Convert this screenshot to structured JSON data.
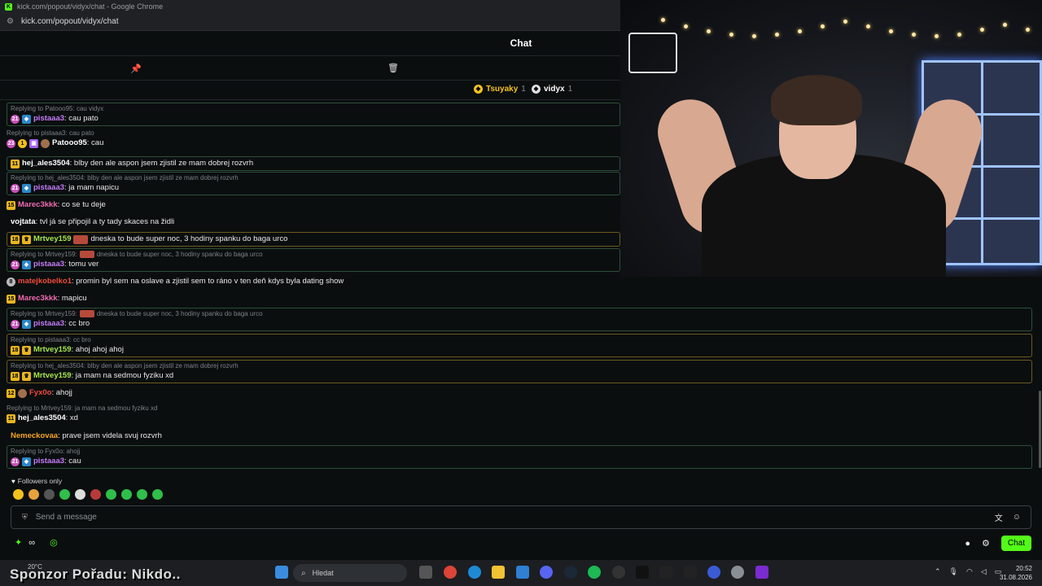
{
  "browser": {
    "window_title": "kick.com/popout/vidyx/chat - Google Chrome",
    "url": "kick.com/popout/vidyx/chat"
  },
  "chat": {
    "title": "Chat",
    "leaderboard": [
      {
        "name": "Tsuyaky",
        "count": "1",
        "color": "#f3c11c"
      },
      {
        "name": "vidyx",
        "count": "1",
        "color": "#ffffff"
      }
    ],
    "messages": [
      {
        "reply": "Replying to Patooo95: cau vidyx",
        "user": "pistaaa3",
        "text": ": cau pato"
      },
      {
        "reply": "Replying to pistaaa3: cau pato",
        "user": "Patooo95",
        "text": ": cau"
      },
      {
        "badge": "11",
        "user": "hej_ales3504",
        "text": ": blby den ale aspon jsem zjistil ze mam dobrej rozvrh"
      },
      {
        "reply": "Replying to hej_ales3504: blby den ale aspon jsem zjistil ze mam dobrej rozvrh",
        "user": "pistaaa3",
        "text": ": ja mam napicu"
      },
      {
        "badge": "15",
        "user": "Marec3kkk",
        "text": ": co se tu deje"
      },
      {
        "user": "vojtata",
        "text": ": tvl já se připojil a ty tady skaces na židli"
      },
      {
        "badge": "18",
        "user": "Mrtvey159",
        "text": "dneska to bude super noc, 3 hodiny spanku do baga urco"
      },
      {
        "reply": "Replying to Mrtvey159:",
        "reply_text": "dneska to bude super noc, 3 hodiny spanku do baga urco",
        "user": "pistaaa3",
        "text": ": tomu ver"
      },
      {
        "badge": "8",
        "user": "matejkobelko1",
        "text": ": promin byl sem na oslave a zjistil sem to ráno v ten deň kdys byla dating show"
      },
      {
        "badge": "15",
        "user": "Marec3kkk",
        "text": ": mapicu"
      },
      {
        "reply": "Replying to Mrtvey159:",
        "reply_text": "dneska to bude super noc, 3 hodiny spanku do baga urco",
        "user": "pistaaa3",
        "text": ": cc bro"
      },
      {
        "reply": "Replying to pistaaa3: cc bro",
        "badge": "18",
        "user": "Mrtvey159",
        "text": ": ahoj ahoj ahoj"
      },
      {
        "reply": "Replying to hej_ales3504: blby den ale aspon jsem zjistil ze mam dobrej rozvrh",
        "badge": "18",
        "user": "Mrtvey159",
        "text": ": ja mam na sedmou fyziku xd"
      },
      {
        "badge": "12",
        "user": "Fyx0o",
        "text": ": ahojj"
      },
      {
        "reply": "Replying to Mrtvey159: ja mam na sedmou fyziku xd",
        "badge": "11",
        "user": "hej_ales3504",
        "text": ": xd"
      },
      {
        "user": "Nemeckovaa",
        "text": ": prave jsem videla svuj rozvrh"
      },
      {
        "reply": "Replying to Fyx0o: ahojj",
        "user": "pistaaa3",
        "text": ": cau"
      }
    ],
    "followers_only": "Followers only",
    "input_placeholder": "Send a message",
    "chat_button": "Chat"
  },
  "overlay": {
    "sponsor_text": "Sponzor Pořadu: Nikdo.."
  },
  "taskbar": {
    "weather": "20°C",
    "search_placeholder": "Hledat",
    "time": "20:52",
    "date": "31.08.2026"
  },
  "colors": {
    "accent": "#53fc18",
    "background": "#0b0e0f"
  }
}
